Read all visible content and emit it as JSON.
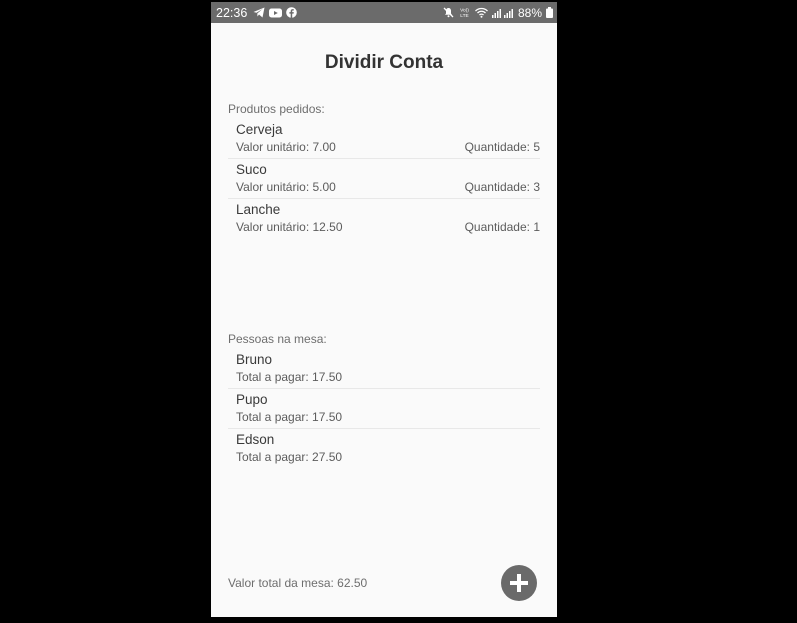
{
  "status_bar": {
    "time": "22:36",
    "battery": "88%",
    "left_icons": [
      "telegram-icon",
      "youtube-icon",
      "facebook-icon"
    ],
    "right_icons": [
      "mute-icon",
      "volte-icon",
      "wifi-icon",
      "signal-icon",
      "battery-icon"
    ]
  },
  "app": {
    "title": "Dividir Conta"
  },
  "products": {
    "section_label": "Produtos pedidos:",
    "items": [
      {
        "name": "Cerveja",
        "unit_value": "Valor unitário: 7.00",
        "quantity": "Quantidade: 5"
      },
      {
        "name": "Suco",
        "unit_value": "Valor unitário: 5.00",
        "quantity": "Quantidade: 3"
      },
      {
        "name": "Lanche",
        "unit_value": "Valor unitário: 12.50",
        "quantity": "Quantidade: 1"
      }
    ]
  },
  "people": {
    "section_label": "Pessoas na mesa:",
    "items": [
      {
        "name": "Bruno",
        "total": "Total a pagar: 17.50"
      },
      {
        "name": "Pupo",
        "total": "Total a pagar: 17.50"
      },
      {
        "name": "Edson",
        "total": "Total a pagar: 27.50"
      }
    ]
  },
  "footer": {
    "total_label": "Valor total da mesa: 62.50",
    "add_icon": "plus-icon"
  },
  "colors": {
    "status_bar": "#6b6b6b",
    "background": "#fafafa",
    "fab": "#6a6a6a",
    "outer": "#000000"
  }
}
